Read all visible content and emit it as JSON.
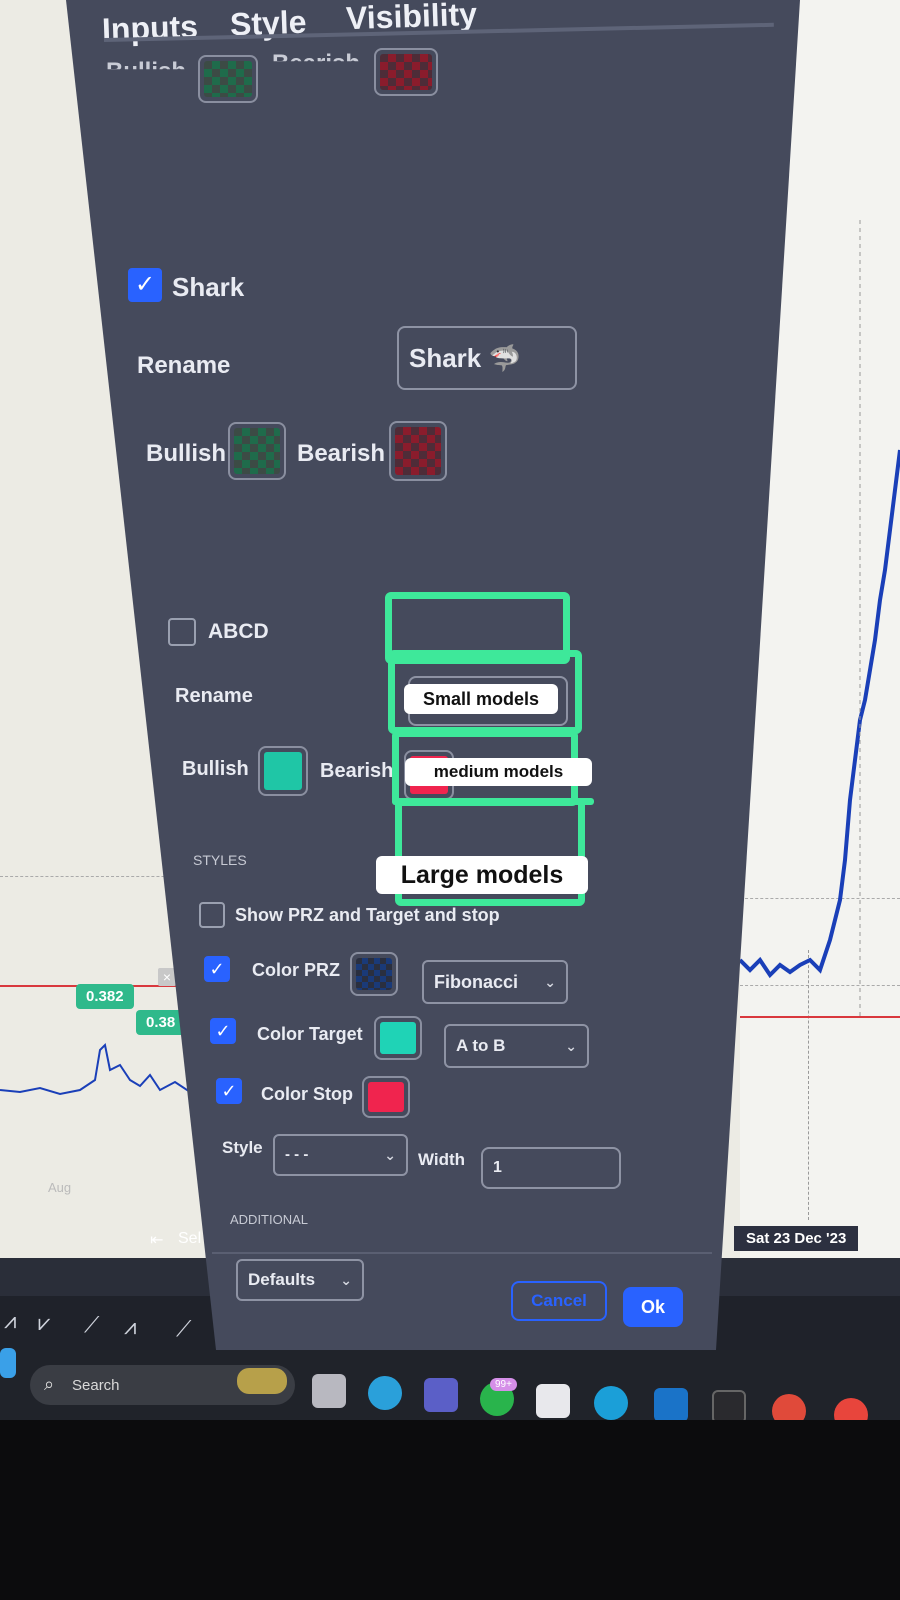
{
  "tabs": [
    "Inputs",
    "Style",
    "Visibility"
  ],
  "prev_section": {
    "bullish": "Bullish",
    "bearish": "Bearish"
  },
  "shark": {
    "label": "Shark",
    "checked": true,
    "rename_label": "Rename",
    "rename_value": "Shark 🦈",
    "bullish": "Bullish",
    "bearish": "Bearish"
  },
  "abcd": {
    "label": "ABCD",
    "checked": false,
    "rename_label": "Rename",
    "bullish": "Bullish",
    "bearish": "Bearish"
  },
  "styles": {
    "heading": "STYLES",
    "show_przz": "Show PRZ and Target and stop",
    "color_prz": "Color PRZ",
    "prz_select": "Fibonacci",
    "color_target": "Color Target",
    "target_select": "A to B",
    "color_stop": "Color Stop",
    "style_label": "Style",
    "style_value": "- - -",
    "width_label": "Width",
    "width_value": "1"
  },
  "additional_heading": "ADDITIONAL",
  "footer": {
    "defaults": "Defaults",
    "cancel": "Cancel",
    "ok": "Ok"
  },
  "annotations": {
    "small": "Small models",
    "medium": "medium models",
    "large": "Large models"
  },
  "chart": {
    "fib1": "0.382",
    "fib2": "0.38",
    "date": "Sat 23 Dec '23",
    "aug": "Aug",
    "select_label": "Sel"
  },
  "taskbar": {
    "search": "Search",
    "badge": "99+"
  },
  "colors": {
    "accent_blue": "#2962ff",
    "annotation_green": "#3ee89a",
    "teal": "#1fc6a6",
    "stop_red": "#f0244e",
    "dialog_bg": "#454a5c"
  }
}
